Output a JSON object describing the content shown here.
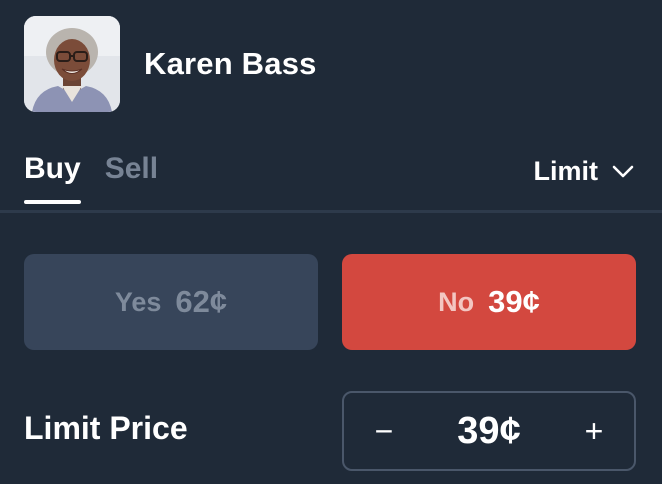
{
  "market": {
    "title": "Karen Bass",
    "avatar_alt": "Karen Bass portrait"
  },
  "tabs": [
    {
      "label": "Buy",
      "active": true
    },
    {
      "label": "Sell",
      "active": false
    }
  ],
  "order_type": {
    "selected": "Limit",
    "icon": "chevron-down-icon"
  },
  "outcomes": {
    "yes": {
      "label": "Yes",
      "price": "62¢",
      "selected": false
    },
    "no": {
      "label": "No",
      "price": "39¢",
      "selected": true
    }
  },
  "limit_price": {
    "label": "Limit Price",
    "value": "39¢",
    "decrement": "−",
    "increment": "+"
  },
  "colors": {
    "background": "#1f2a38",
    "no_accent": "#d3483f",
    "yes_inactive": "#37455a"
  }
}
